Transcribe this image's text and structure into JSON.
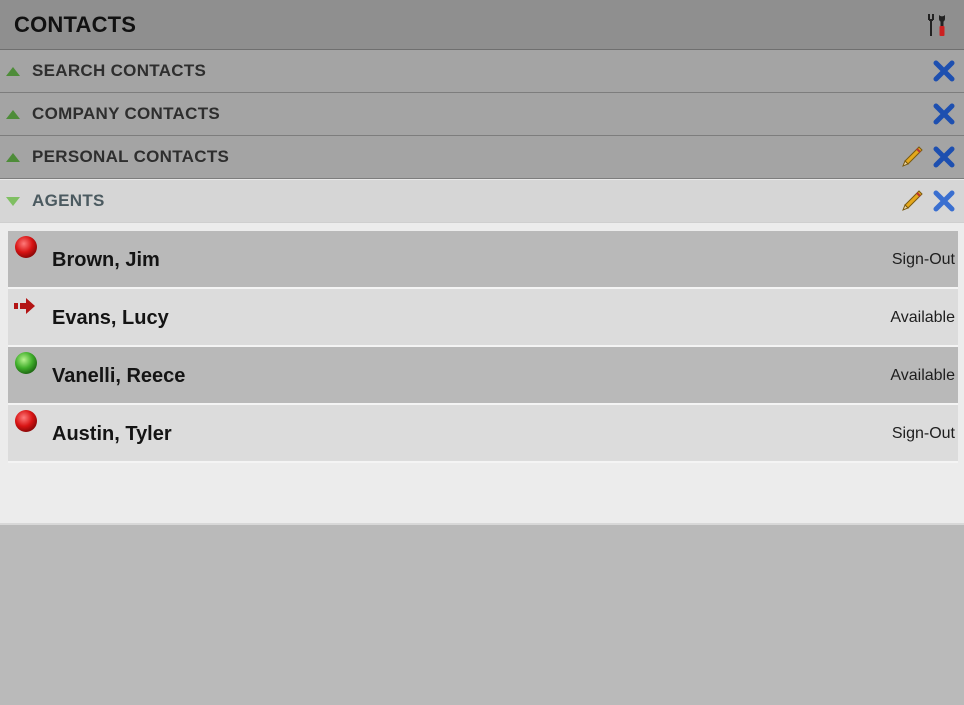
{
  "header": {
    "title": "CONTACTS",
    "tools_icon": "tools-icon"
  },
  "sections": [
    {
      "label": "SEARCH CONTACTS",
      "expanded": false,
      "editable": false
    },
    {
      "label": "COMPANY CONTACTS",
      "expanded": false,
      "editable": false
    },
    {
      "label": "PERSONAL CONTACTS",
      "expanded": false,
      "editable": true
    },
    {
      "label": "AGENTS",
      "expanded": true,
      "editable": true
    }
  ],
  "agents": [
    {
      "name": "Brown, Jim",
      "status": "Sign-Out",
      "status_icon": "red-dot-icon"
    },
    {
      "name": "Evans, Lucy",
      "status": "Available",
      "status_icon": "red-arrow-icon"
    },
    {
      "name": "Vanelli, Reece",
      "status": "Available",
      "status_icon": "green-dot-icon"
    },
    {
      "name": "Austin, Tyler",
      "status": "Sign-Out",
      "status_icon": "red-dot-icon"
    }
  ],
  "colors": {
    "header_bg": "#8f8f8f",
    "section_bg": "#a4a4a4",
    "expand_green": "#4e8c39",
    "close_blue": "#1d4fb0",
    "sign_out_red": "#d21e1e",
    "available_green": "#3fae2a"
  }
}
